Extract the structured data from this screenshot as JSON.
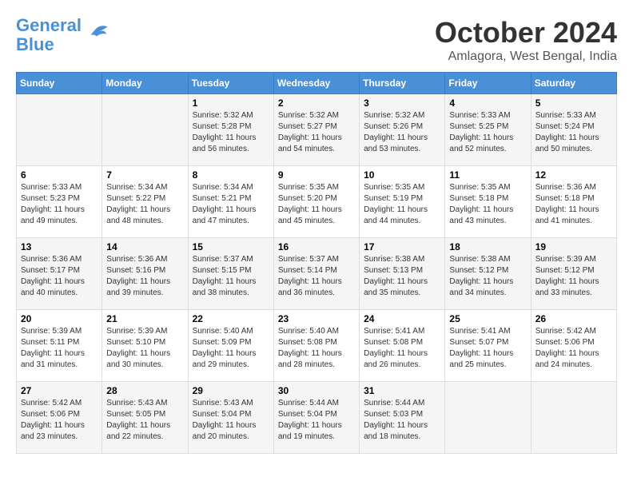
{
  "header": {
    "logo_line1": "General",
    "logo_line2": "Blue",
    "month_title": "October 2024",
    "location": "Amlagora, West Bengal, India"
  },
  "weekdays": [
    "Sunday",
    "Monday",
    "Tuesday",
    "Wednesday",
    "Thursday",
    "Friday",
    "Saturday"
  ],
  "weeks": [
    [
      {
        "day": "",
        "sunrise": "",
        "sunset": "",
        "daylight": ""
      },
      {
        "day": "",
        "sunrise": "",
        "sunset": "",
        "daylight": ""
      },
      {
        "day": "1",
        "sunrise": "Sunrise: 5:32 AM",
        "sunset": "Sunset: 5:28 PM",
        "daylight": "Daylight: 11 hours and 56 minutes."
      },
      {
        "day": "2",
        "sunrise": "Sunrise: 5:32 AM",
        "sunset": "Sunset: 5:27 PM",
        "daylight": "Daylight: 11 hours and 54 minutes."
      },
      {
        "day": "3",
        "sunrise": "Sunrise: 5:32 AM",
        "sunset": "Sunset: 5:26 PM",
        "daylight": "Daylight: 11 hours and 53 minutes."
      },
      {
        "day": "4",
        "sunrise": "Sunrise: 5:33 AM",
        "sunset": "Sunset: 5:25 PM",
        "daylight": "Daylight: 11 hours and 52 minutes."
      },
      {
        "day": "5",
        "sunrise": "Sunrise: 5:33 AM",
        "sunset": "Sunset: 5:24 PM",
        "daylight": "Daylight: 11 hours and 50 minutes."
      }
    ],
    [
      {
        "day": "6",
        "sunrise": "Sunrise: 5:33 AM",
        "sunset": "Sunset: 5:23 PM",
        "daylight": "Daylight: 11 hours and 49 minutes."
      },
      {
        "day": "7",
        "sunrise": "Sunrise: 5:34 AM",
        "sunset": "Sunset: 5:22 PM",
        "daylight": "Daylight: 11 hours and 48 minutes."
      },
      {
        "day": "8",
        "sunrise": "Sunrise: 5:34 AM",
        "sunset": "Sunset: 5:21 PM",
        "daylight": "Daylight: 11 hours and 47 minutes."
      },
      {
        "day": "9",
        "sunrise": "Sunrise: 5:35 AM",
        "sunset": "Sunset: 5:20 PM",
        "daylight": "Daylight: 11 hours and 45 minutes."
      },
      {
        "day": "10",
        "sunrise": "Sunrise: 5:35 AM",
        "sunset": "Sunset: 5:19 PM",
        "daylight": "Daylight: 11 hours and 44 minutes."
      },
      {
        "day": "11",
        "sunrise": "Sunrise: 5:35 AM",
        "sunset": "Sunset: 5:18 PM",
        "daylight": "Daylight: 11 hours and 43 minutes."
      },
      {
        "day": "12",
        "sunrise": "Sunrise: 5:36 AM",
        "sunset": "Sunset: 5:18 PM",
        "daylight": "Daylight: 11 hours and 41 minutes."
      }
    ],
    [
      {
        "day": "13",
        "sunrise": "Sunrise: 5:36 AM",
        "sunset": "Sunset: 5:17 PM",
        "daylight": "Daylight: 11 hours and 40 minutes."
      },
      {
        "day": "14",
        "sunrise": "Sunrise: 5:36 AM",
        "sunset": "Sunset: 5:16 PM",
        "daylight": "Daylight: 11 hours and 39 minutes."
      },
      {
        "day": "15",
        "sunrise": "Sunrise: 5:37 AM",
        "sunset": "Sunset: 5:15 PM",
        "daylight": "Daylight: 11 hours and 38 minutes."
      },
      {
        "day": "16",
        "sunrise": "Sunrise: 5:37 AM",
        "sunset": "Sunset: 5:14 PM",
        "daylight": "Daylight: 11 hours and 36 minutes."
      },
      {
        "day": "17",
        "sunrise": "Sunrise: 5:38 AM",
        "sunset": "Sunset: 5:13 PM",
        "daylight": "Daylight: 11 hours and 35 minutes."
      },
      {
        "day": "18",
        "sunrise": "Sunrise: 5:38 AM",
        "sunset": "Sunset: 5:12 PM",
        "daylight": "Daylight: 11 hours and 34 minutes."
      },
      {
        "day": "19",
        "sunrise": "Sunrise: 5:39 AM",
        "sunset": "Sunset: 5:12 PM",
        "daylight": "Daylight: 11 hours and 33 minutes."
      }
    ],
    [
      {
        "day": "20",
        "sunrise": "Sunrise: 5:39 AM",
        "sunset": "Sunset: 5:11 PM",
        "daylight": "Daylight: 11 hours and 31 minutes."
      },
      {
        "day": "21",
        "sunrise": "Sunrise: 5:39 AM",
        "sunset": "Sunset: 5:10 PM",
        "daylight": "Daylight: 11 hours and 30 minutes."
      },
      {
        "day": "22",
        "sunrise": "Sunrise: 5:40 AM",
        "sunset": "Sunset: 5:09 PM",
        "daylight": "Daylight: 11 hours and 29 minutes."
      },
      {
        "day": "23",
        "sunrise": "Sunrise: 5:40 AM",
        "sunset": "Sunset: 5:08 PM",
        "daylight": "Daylight: 11 hours and 28 minutes."
      },
      {
        "day": "24",
        "sunrise": "Sunrise: 5:41 AM",
        "sunset": "Sunset: 5:08 PM",
        "daylight": "Daylight: 11 hours and 26 minutes."
      },
      {
        "day": "25",
        "sunrise": "Sunrise: 5:41 AM",
        "sunset": "Sunset: 5:07 PM",
        "daylight": "Daylight: 11 hours and 25 minutes."
      },
      {
        "day": "26",
        "sunrise": "Sunrise: 5:42 AM",
        "sunset": "Sunset: 5:06 PM",
        "daylight": "Daylight: 11 hours and 24 minutes."
      }
    ],
    [
      {
        "day": "27",
        "sunrise": "Sunrise: 5:42 AM",
        "sunset": "Sunset: 5:06 PM",
        "daylight": "Daylight: 11 hours and 23 minutes."
      },
      {
        "day": "28",
        "sunrise": "Sunrise: 5:43 AM",
        "sunset": "Sunset: 5:05 PM",
        "daylight": "Daylight: 11 hours and 22 minutes."
      },
      {
        "day": "29",
        "sunrise": "Sunrise: 5:43 AM",
        "sunset": "Sunset: 5:04 PM",
        "daylight": "Daylight: 11 hours and 20 minutes."
      },
      {
        "day": "30",
        "sunrise": "Sunrise: 5:44 AM",
        "sunset": "Sunset: 5:04 PM",
        "daylight": "Daylight: 11 hours and 19 minutes."
      },
      {
        "day": "31",
        "sunrise": "Sunrise: 5:44 AM",
        "sunset": "Sunset: 5:03 PM",
        "daylight": "Daylight: 11 hours and 18 minutes."
      },
      {
        "day": "",
        "sunrise": "",
        "sunset": "",
        "daylight": ""
      },
      {
        "day": "",
        "sunrise": "",
        "sunset": "",
        "daylight": ""
      }
    ]
  ]
}
